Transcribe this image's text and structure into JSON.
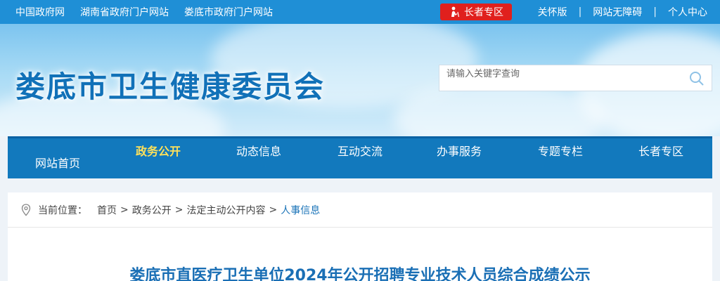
{
  "topbar": {
    "left_links": [
      "中国政府网",
      "湖南省政府门户网站",
      "娄底市政府门户网站"
    ],
    "elder_button": "长者专区",
    "right_links": [
      "关怀版",
      "网站无障碍",
      "个人中心"
    ],
    "right_separator": "|"
  },
  "header": {
    "site_title": "娄底市卫生健康委员会",
    "search_placeholder": "请输入关键字查询"
  },
  "nav": {
    "items": [
      "网站首页",
      "政务公开",
      "动态信息",
      "互动交流",
      "办事服务",
      "专题专栏",
      "长者专区"
    ],
    "active_index": 1
  },
  "breadcrumb": {
    "label": "当前位置：",
    "items": [
      "首页",
      "政务公开",
      "法定主动公开内容",
      "人事信息"
    ],
    "separator": ">"
  },
  "article": {
    "title": "娄底市直医疗卫生单位2024年公开招聘专业技术人员综合成绩公示"
  },
  "colors": {
    "topbar": "#1f8fd6",
    "nav": "#1279bd",
    "title": "#1171b8",
    "active_nav": "#ffe15a",
    "elder_button": "#e0201d"
  }
}
